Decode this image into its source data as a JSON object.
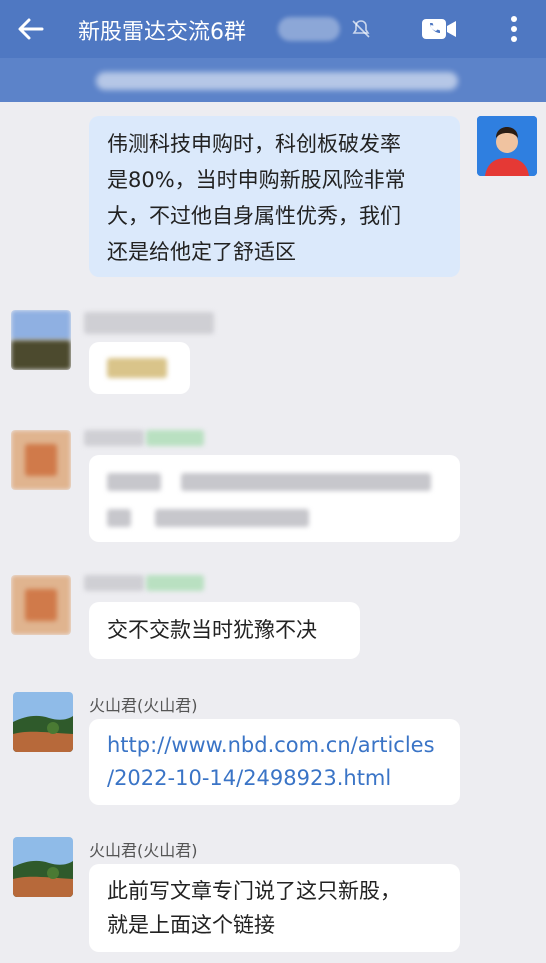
{
  "header": {
    "title": "新股雷达交流6群",
    "icons": {
      "back": "back-arrow-icon",
      "mute": "muted-bell-icon",
      "video": "video-call-icon",
      "more": "more-vertical-icon"
    }
  },
  "messages": [
    {
      "from": "self",
      "text_lines": [
        "伟测科技申购时，科创板破发率",
        "是80%，当时申购新股风险非常",
        "大，不过他自身属性优秀，我们",
        "还是给他定了舒适区"
      ]
    },
    {
      "from": "other",
      "sender": "",
      "text": ""
    },
    {
      "from": "other",
      "sender": "",
      "text": ""
    },
    {
      "from": "other",
      "sender": "",
      "text": "交不交款当时犹豫不决"
    },
    {
      "from": "other",
      "sender": "火山君(火山君)",
      "text_lines": [
        "http://www.nbd.com.cn/articles",
        "/2022-10-14/2498923.html"
      ]
    },
    {
      "from": "other",
      "sender": "火山君(火山君)",
      "text_lines": [
        "此前写文章专门说了这只新股，",
        "就是上面这个链接"
      ]
    }
  ],
  "colors": {
    "header": "#4f78c2",
    "notice": "#5c83c9",
    "self_bubble": "#dbe9fb",
    "link": "#3a74c6",
    "background": "#ededf1"
  }
}
